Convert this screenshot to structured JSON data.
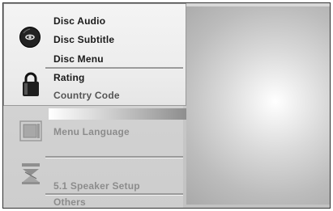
{
  "menu": {
    "groups": [
      {
        "icon": "disc-icon",
        "items": [
          "Disc Audio",
          "Disc Subtitle",
          "Disc Menu"
        ]
      },
      {
        "icon": "padlock-icon",
        "items": [
          "Rating",
          "Country Code"
        ]
      },
      {
        "icon": "display-icon",
        "items": [
          "Menu Language"
        ]
      },
      {
        "icon": "speaker-icon",
        "items": [
          "5.1 Speaker Setup",
          "Others"
        ]
      }
    ]
  }
}
